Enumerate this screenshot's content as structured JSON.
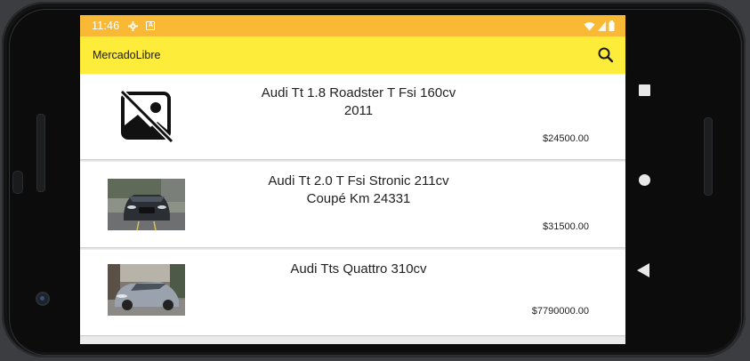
{
  "status_bar": {
    "time": "11:46",
    "icons": [
      "gear-icon",
      "a-box-icon",
      "wifi-icon",
      "signal-icon",
      "battery-icon"
    ]
  },
  "toolbar": {
    "title": "MercadoLibre",
    "search_icon": "search-icon"
  },
  "colors": {
    "status_bar": "#f9b934",
    "toolbar": "#feec3b",
    "list_bg": "#ebebeb",
    "card_bg": "#ffffff"
  },
  "items": [
    {
      "title": "Audi Tt 1.8 Roadster T Fsi 160cv 2011",
      "price": "$24500.00",
      "image": "no-image-icon"
    },
    {
      "title": "Audi Tt 2.0 T Fsi Stronic 211cv Coupé Km 24331",
      "price": "$31500.00",
      "image": "car-photo-dark-audi"
    },
    {
      "title": "Audi Tts Quattro 310cv",
      "price": "$7790000.00",
      "image": "car-photo-grey-audi"
    }
  ]
}
